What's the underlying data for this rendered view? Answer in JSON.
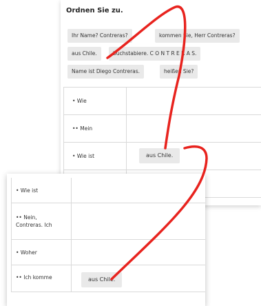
{
  "exercise": {
    "title": "Ordnen Sie zu.",
    "chips": [
      "Ihr Name? Contreras?",
      "kommen Sie, Herr Contreras?",
      "aus Chile.",
      "buchstabiere. C O N T R E R A S.",
      "Name ist Diego Contreras.",
      "heißen Sie?"
    ],
    "rows": [
      {
        "label": "• Wie",
        "answer": ""
      },
      {
        "label": "•• Mein",
        "answer": ""
      },
      {
        "label": "• Wie ist",
        "answer": "aus Chile."
      }
    ]
  },
  "zoomed": {
    "rows": [
      {
        "label": "• Wie ist",
        "answer": ""
      },
      {
        "label": "•• Nein,\nContreras. Ich",
        "answer": ""
      },
      {
        "label": "• Woher",
        "answer": ""
      },
      {
        "label": "•• Ich komme",
        "answer": "aus Chile."
      }
    ]
  },
  "annotation": {
    "stroke_color": "#e8231e"
  }
}
